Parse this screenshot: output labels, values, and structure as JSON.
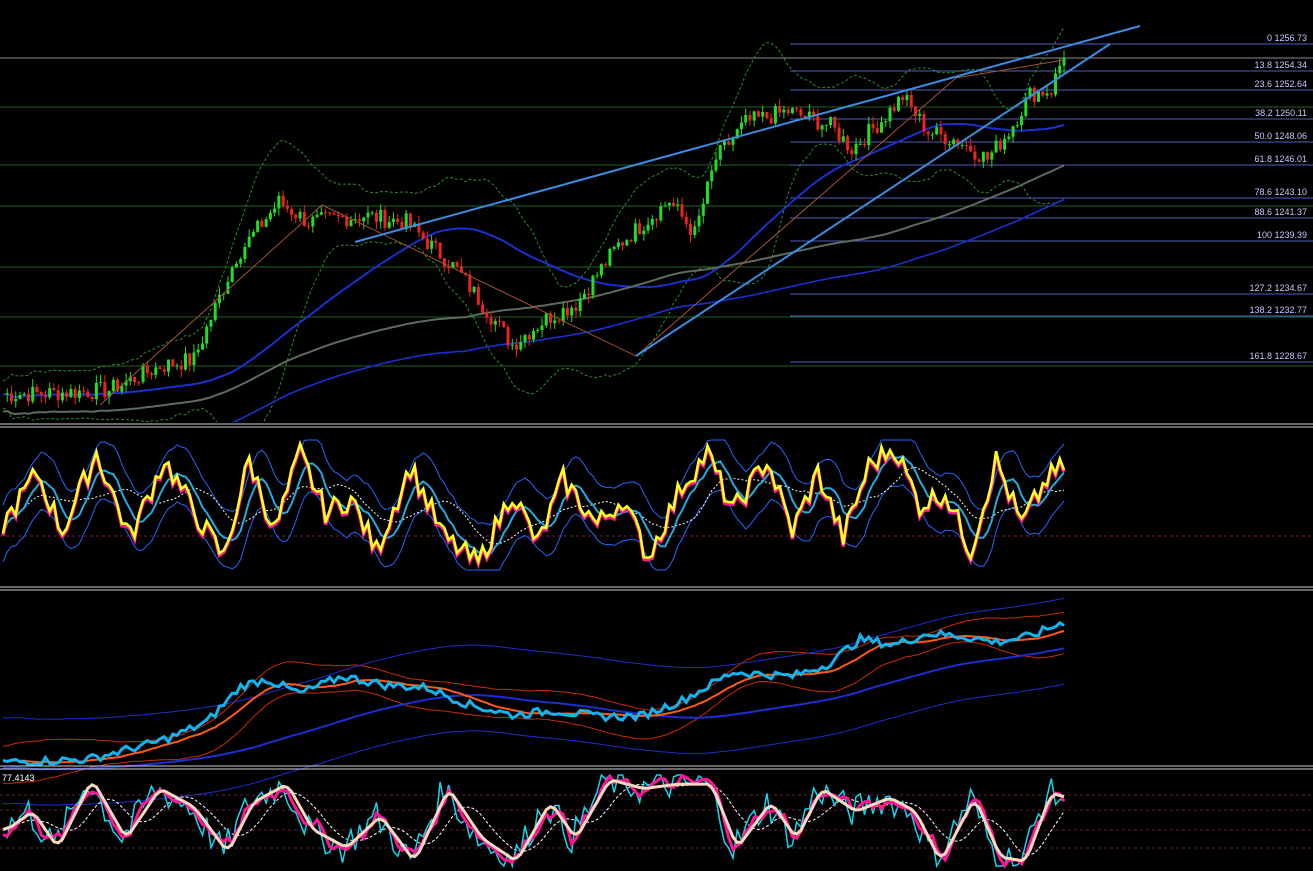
{
  "colors": {
    "background": "#000000",
    "candle_up": "#22dd22",
    "candle_down": "#ee2222",
    "fib_line": "#4a5fc0",
    "fib_text": "#c8c8ff",
    "price_h_green": "#1f5f1f",
    "price_h_gray": "#8a8a8a",
    "trendline": "#3a8ce0",
    "ma_blue": "#1a2fd0",
    "ma_gray": "#5d6b5d",
    "bb_green": "#2a8a2a",
    "zigzag": "#a0522d",
    "rsi_main": "#ffff20",
    "rsi_shadow": "#ff1493",
    "rsi_band_cyan": "#22aadd",
    "rsi_band_blue": "#2266ff",
    "osc_cyan": "#11b4ee",
    "osc_orange": "#ff5a10",
    "osc_band": "#cc2a00",
    "stoch_main": "#ffd8c0",
    "stoch_pink": "#ff1493",
    "stoch_cyan": "#11d8ee",
    "separator": "#d0d0d0"
  },
  "chart_data": [
    {
      "type": "candlestick",
      "panel": "price",
      "fib_levels": [
        {
          "label": "0 1256.73",
          "ratio": 0,
          "price": 1256.73
        },
        {
          "label": "13.8 1254.34",
          "ratio": 13.8,
          "price": 1254.34
        },
        {
          "label": "23.6 1252.64",
          "ratio": 23.6,
          "price": 1252.64
        },
        {
          "label": "38.2 1250.11",
          "ratio": 38.2,
          "price": 1250.11
        },
        {
          "label": "50.0 1248.06",
          "ratio": 50.0,
          "price": 1248.06
        },
        {
          "label": "61.8 1246.01",
          "ratio": 61.8,
          "price": 1246.01
        },
        {
          "label": "78.6 1243.10",
          "ratio": 78.6,
          "price": 1243.1
        },
        {
          "label": "88.6 1241.37",
          "ratio": 88.6,
          "price": 1241.37
        },
        {
          "label": "100 1239.39",
          "ratio": 100,
          "price": 1239.39
        },
        {
          "label": "127.2 1234.67",
          "ratio": 127.2,
          "price": 1234.67
        },
        {
          "label": "138.2 1232.77",
          "ratio": 138.2,
          "price": 1232.77
        },
        {
          "label": "161.8 1228.67",
          "ratio": 161.8,
          "price": 1228.67
        }
      ],
      "close_anchors": [
        [
          0,
          1225.8
        ],
        [
          10,
          1225.9
        ],
        [
          25,
          1226.2
        ],
        [
          37,
          1228.3
        ],
        [
          45,
          1228.9
        ],
        [
          55,
          1238.0
        ],
        [
          65,
          1242.8
        ],
        [
          72,
          1241.0
        ],
        [
          85,
          1241.6
        ],
        [
          95,
          1241.0
        ],
        [
          107,
          1236.8
        ],
        [
          120,
          1230.2
        ],
        [
          128,
          1232.5
        ],
        [
          135,
          1233.8
        ],
        [
          145,
          1239.0
        ],
        [
          157,
          1242.9
        ],
        [
          163,
          1240.0
        ],
        [
          168,
          1246.6
        ],
        [
          175,
          1249.8
        ],
        [
          185,
          1250.8
        ],
        [
          195,
          1249.5
        ],
        [
          200,
          1247.5
        ],
        [
          207,
          1250.0
        ],
        [
          212,
          1252.1
        ],
        [
          218,
          1249.0
        ],
        [
          225,
          1248.2
        ],
        [
          232,
          1246.6
        ],
        [
          237,
          1249.0
        ],
        [
          242,
          1252.3
        ],
        [
          247,
          1252.7
        ],
        [
          250,
          1255.9
        ]
      ]
    },
    {
      "type": "line",
      "panel": "rsi",
      "series": [
        {
          "color_key": "rsi_main",
          "anchors": [
            [
              0,
              0.35
            ],
            [
              8,
              0.75
            ],
            [
              14,
              0.3
            ],
            [
              22,
              0.9
            ],
            [
              30,
              0.25
            ],
            [
              38,
              0.85
            ],
            [
              46,
              0.4
            ],
            [
              52,
              0.1
            ],
            [
              58,
              0.85
            ],
            [
              64,
              0.3
            ],
            [
              70,
              0.9
            ],
            [
              76,
              0.45
            ],
            [
              82,
              0.55
            ],
            [
              88,
              0.15
            ],
            [
              96,
              0.8
            ],
            [
              104,
              0.25
            ],
            [
              112,
              0.05
            ],
            [
              120,
              0.6
            ],
            [
              126,
              0.2
            ],
            [
              132,
              0.7
            ],
            [
              140,
              0.35
            ],
            [
              146,
              0.55
            ],
            [
              152,
              0.1
            ],
            [
              160,
              0.65
            ],
            [
              166,
              0.9
            ],
            [
              172,
              0.45
            ],
            [
              180,
              0.85
            ],
            [
              186,
              0.3
            ],
            [
              192,
              0.75
            ],
            [
              198,
              0.25
            ],
            [
              204,
              0.8
            ],
            [
              210,
              0.95
            ],
            [
              216,
              0.5
            ],
            [
              222,
              0.6
            ],
            [
              228,
              0.15
            ],
            [
              234,
              0.85
            ],
            [
              240,
              0.35
            ],
            [
              246,
              0.7
            ],
            [
              250,
              0.8
            ]
          ]
        }
      ]
    },
    {
      "type": "line",
      "panel": "momentum",
      "series": [
        {
          "color_key": "osc_cyan",
          "anchors": [
            [
              0,
              0.02
            ],
            [
              20,
              0.04
            ],
            [
              35,
              0.15
            ],
            [
              40,
              0.2
            ],
            [
              48,
              0.3
            ],
            [
              56,
              0.55
            ],
            [
              62,
              0.6
            ],
            [
              70,
              0.5
            ],
            [
              80,
              0.62
            ],
            [
              90,
              0.56
            ],
            [
              100,
              0.54
            ],
            [
              110,
              0.42
            ],
            [
              120,
              0.35
            ],
            [
              130,
              0.38
            ],
            [
              140,
              0.34
            ],
            [
              150,
              0.34
            ],
            [
              160,
              0.45
            ],
            [
              172,
              0.65
            ],
            [
              186,
              0.62
            ],
            [
              194,
              0.7
            ],
            [
              202,
              0.88
            ],
            [
              210,
              0.84
            ],
            [
              218,
              0.92
            ],
            [
              226,
              0.9
            ],
            [
              234,
              0.86
            ],
            [
              242,
              0.9
            ],
            [
              250,
              1.0
            ]
          ]
        }
      ]
    },
    {
      "type": "line",
      "panel": "stochastic",
      "value_label": "77.4143",
      "series": [
        {
          "color_key": "stoch_main",
          "anchors": [
            [
              0,
              0.4
            ],
            [
              6,
              0.6
            ],
            [
              12,
              0.2
            ],
            [
              20,
              0.95
            ],
            [
              28,
              0.3
            ],
            [
              36,
              0.85
            ],
            [
              44,
              0.65
            ],
            [
              52,
              0.15
            ],
            [
              58,
              0.7
            ],
            [
              66,
              0.9
            ],
            [
              72,
              0.4
            ],
            [
              80,
              0.2
            ],
            [
              88,
              0.55
            ],
            [
              96,
              0.05
            ],
            [
              104,
              0.85
            ],
            [
              112,
              0.3
            ],
            [
              120,
              0.05
            ],
            [
              128,
              0.7
            ],
            [
              134,
              0.3
            ],
            [
              142,
              0.95
            ],
            [
              150,
              0.85
            ],
            [
              158,
              0.9
            ],
            [
              166,
              0.9
            ],
            [
              172,
              0.2
            ],
            [
              180,
              0.7
            ],
            [
              186,
              0.3
            ],
            [
              192,
              0.85
            ],
            [
              200,
              0.6
            ],
            [
              208,
              0.75
            ],
            [
              214,
              0.6
            ],
            [
              220,
              0.05
            ],
            [
              228,
              0.75
            ],
            [
              234,
              0.1
            ],
            [
              240,
              0.05
            ],
            [
              246,
              0.8
            ],
            [
              250,
              0.75
            ]
          ]
        }
      ]
    }
  ]
}
